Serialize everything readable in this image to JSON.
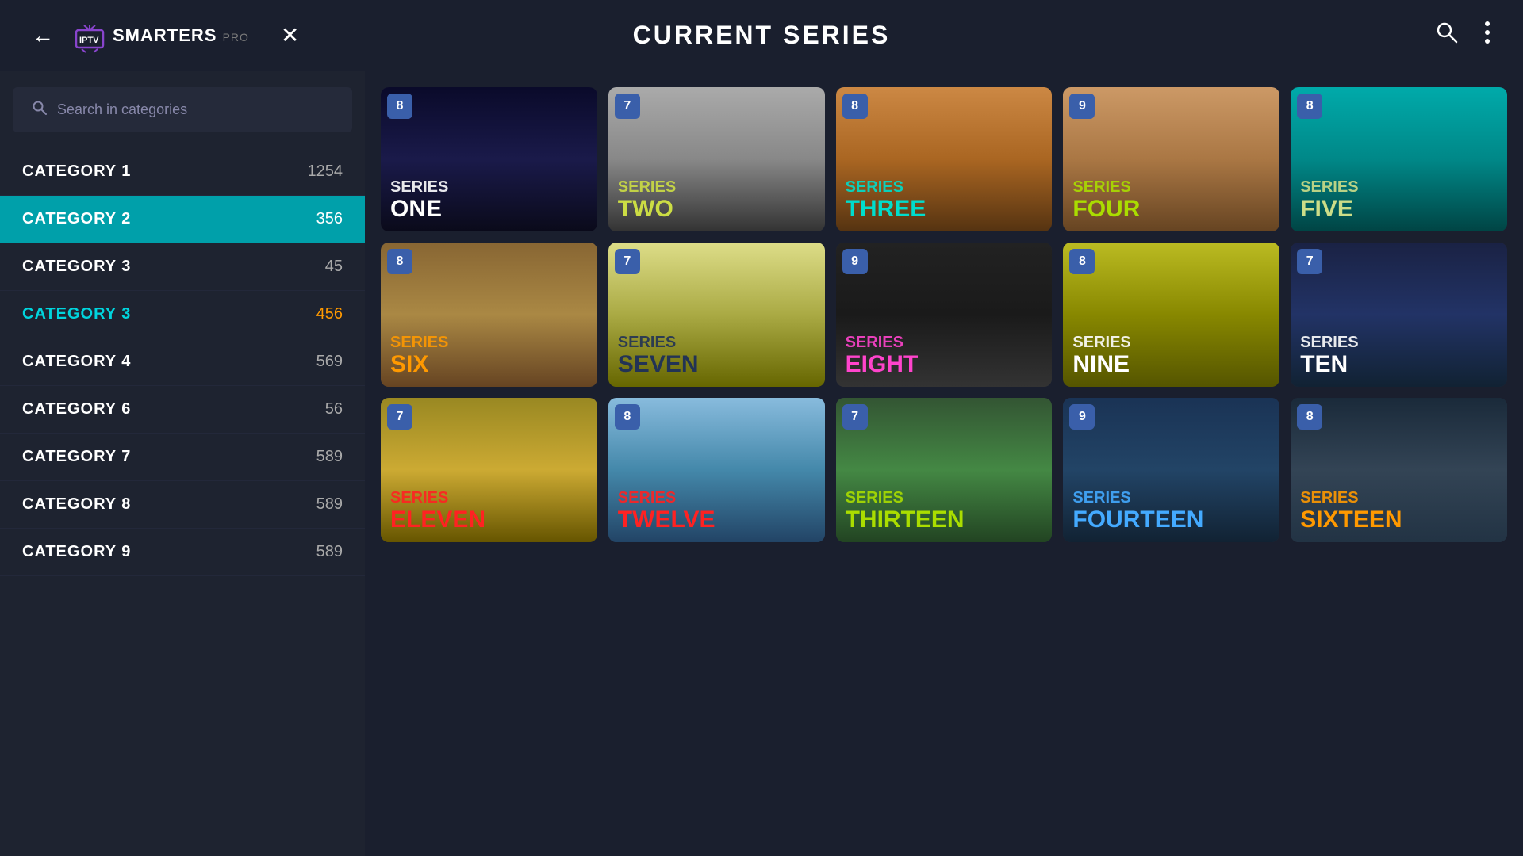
{
  "header": {
    "title": "CURRENT SERIES",
    "logo_text": "IPTV",
    "logo_smarters": "SMARTERS",
    "logo_pro": "PRO",
    "back_label": "←",
    "close_label": "✕"
  },
  "sidebar": {
    "search_placeholder": "Search in categories",
    "categories": [
      {
        "id": 1,
        "name": "CATEGORY  1",
        "count": "1254",
        "active": false,
        "highlighted": false
      },
      {
        "id": 2,
        "name": "CATEGORY  2",
        "count": "356",
        "active": true,
        "highlighted": false
      },
      {
        "id": 3,
        "name": "CATEGORY  3",
        "count": "45",
        "active": false,
        "highlighted": false
      },
      {
        "id": 4,
        "name": "CATEGORY 3",
        "count": "456",
        "active": false,
        "highlighted": true
      },
      {
        "id": 5,
        "name": "CATEGORY  4",
        "count": "569",
        "active": false,
        "highlighted": false
      },
      {
        "id": 6,
        "name": "CATEGORY  6",
        "count": "56",
        "active": false,
        "highlighted": false
      },
      {
        "id": 7,
        "name": "CATEGORY  7",
        "count": "589",
        "active": false,
        "highlighted": false
      },
      {
        "id": 8,
        "name": "CATEGORY  8",
        "count": "589",
        "active": false,
        "highlighted": false
      },
      {
        "id": 9,
        "name": "CATEGORY  9",
        "count": "589",
        "active": false,
        "highlighted": false
      }
    ]
  },
  "grid": {
    "cards": [
      {
        "id": 1,
        "badge": "8",
        "line1": "SERIES",
        "line2": "ONE",
        "title_color": "white",
        "class": "card-1"
      },
      {
        "id": 2,
        "badge": "7",
        "line1": "SERIES",
        "line2": "TWO",
        "title_color": "#ccdd44",
        "class": "card-2"
      },
      {
        "id": 3,
        "badge": "8",
        "line1": "SERIES",
        "line2": "THREE",
        "title_color": "#00ddcc",
        "class": "card-3"
      },
      {
        "id": 4,
        "badge": "9",
        "line1": "SERIES",
        "line2": "FOUR",
        "title_color": "#aadd00",
        "class": "card-4"
      },
      {
        "id": 5,
        "badge": "8",
        "line1": "SERIES",
        "line2": "FIVE",
        "title_color": "#ccdd88",
        "class": "card-5"
      },
      {
        "id": 6,
        "badge": "8",
        "line1": "SERIES",
        "line2": "SIX",
        "title_color": "#ff9900",
        "class": "card-6"
      },
      {
        "id": 7,
        "badge": "7",
        "line1": "SERIES",
        "line2": "SEVEN",
        "title_color": "#223355",
        "class": "card-7"
      },
      {
        "id": 8,
        "badge": "9",
        "line1": "SERIES",
        "line2": "EIGHT",
        "title_color": "#ff44cc",
        "class": "card-8"
      },
      {
        "id": 9,
        "badge": "8",
        "line1": "SERIES",
        "line2": "NINE",
        "title_color": "white",
        "class": "card-9"
      },
      {
        "id": 10,
        "badge": "7",
        "line1": "SERIES",
        "line2": "TEN",
        "title_color": "white",
        "class": "card-10"
      },
      {
        "id": 11,
        "badge": "7",
        "line1": "SERIES",
        "line2": "ELEVEN",
        "title_color": "#ff2222",
        "class": "card-11"
      },
      {
        "id": 12,
        "badge": "8",
        "line1": "SERIES",
        "line2": "TWELVE",
        "title_color": "#ff2222",
        "class": "card-12"
      },
      {
        "id": 13,
        "badge": "7",
        "line1": "SERIES",
        "line2": "THIRTEEN",
        "title_color": "#aadd00",
        "class": "card-13"
      },
      {
        "id": 14,
        "badge": "9",
        "line1": "SERIES",
        "line2": "FOURTEEN",
        "title_color": "#44aaff",
        "class": "card-14"
      },
      {
        "id": 15,
        "badge": "8",
        "line1": "SERIES",
        "line2": "SIXTEEN",
        "title_color": "#ff9900",
        "class": "card-15"
      }
    ]
  }
}
